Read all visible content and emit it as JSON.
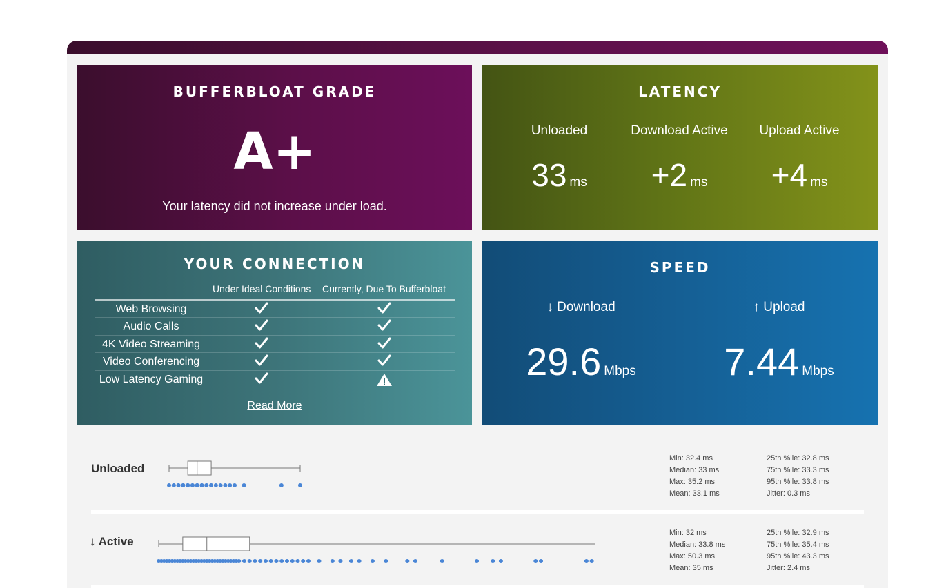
{
  "grade": {
    "title": "BUFFERBLOAT GRADE",
    "value": "A+",
    "description": "Your latency did not increase under load."
  },
  "latency": {
    "title": "LATENCY",
    "columns": [
      {
        "label": "Unloaded",
        "value": "33",
        "unit": "ms"
      },
      {
        "label": "Download Active",
        "value": "+2",
        "unit": "ms"
      },
      {
        "label": "Upload Active",
        "value": "+4",
        "unit": "ms"
      }
    ]
  },
  "connection": {
    "title": "YOUR CONNECTION",
    "col_ideal": "Under Ideal Conditions",
    "col_current": "Currently, Due To Bufferbloat",
    "rows": [
      {
        "name": "Web Browsing",
        "ideal": "check-icon",
        "current": "check-icon"
      },
      {
        "name": "Audio Calls",
        "ideal": "check-icon",
        "current": "check-icon"
      },
      {
        "name": "4K Video Streaming",
        "ideal": "check-icon",
        "current": "check-icon"
      },
      {
        "name": "Video Conferencing",
        "ideal": "check-icon",
        "current": "check-icon"
      },
      {
        "name": "Low Latency Gaming",
        "ideal": "check-icon",
        "current": "warning-icon"
      }
    ],
    "read_more": "Read More"
  },
  "speed": {
    "title": "SPEED",
    "download": {
      "label": "↓ Download",
      "value": "29.6",
      "unit": "Mbps"
    },
    "upload": {
      "label": "↑ Upload",
      "value": "7.44",
      "unit": "Mbps"
    }
  },
  "unloaded": {
    "label": "Unloaded",
    "stats_left": [
      "Min: 32.4 ms",
      "Median: 33 ms",
      "Max: 35.2 ms",
      "Mean: 33.1 ms"
    ],
    "stats_right": [
      "25th %ile: 32.8 ms",
      "75th %ile: 33.3 ms",
      "95th %ile: 33.8 ms",
      "Jitter: 0.3 ms"
    ],
    "box": {
      "min": 32.4,
      "q1": 32.8,
      "median": 33,
      "q3": 33.3,
      "max": 35.2
    },
    "samples": [
      32.4,
      32.5,
      32.5,
      32.6,
      32.6,
      32.7,
      32.7,
      32.8,
      32.8,
      32.8,
      32.9,
      32.9,
      33.0,
      33.0,
      33.0,
      33.1,
      33.1,
      33.2,
      33.2,
      33.3,
      33.3,
      33.4,
      33.5,
      33.6,
      33.7,
      33.8,
      34.0,
      34.8,
      35.2
    ]
  },
  "download_active": {
    "label": "↓ Active",
    "stats_left": [
      "Min: 32 ms",
      "Median: 33.8 ms",
      "Max: 50.3 ms",
      "Mean: 35 ms"
    ],
    "stats_right": [
      "25th %ile: 32.9 ms",
      "75th %ile: 35.4 ms",
      "95th %ile: 43.3 ms",
      "Jitter: 2.4 ms"
    ],
    "box": {
      "min": 32,
      "q1": 32.9,
      "median": 33.8,
      "q3": 35.4,
      "max": 50.3
    },
    "samples": [
      32.0,
      32.1,
      32.2,
      32.3,
      32.4,
      32.5,
      32.6,
      32.7,
      32.8,
      32.9,
      33.0,
      33.1,
      33.2,
      33.3,
      33.4,
      33.5,
      33.6,
      33.7,
      33.8,
      33.9,
      34.0,
      34.1,
      34.2,
      34.3,
      34.4,
      34.5,
      34.6,
      34.7,
      34.8,
      34.9,
      35.0,
      35.2,
      35.4,
      35.6,
      35.8,
      36.0,
      36.2,
      36.4,
      36.6,
      36.8,
      37.0,
      37.2,
      37.4,
      37.6,
      38.0,
      38.5,
      38.8,
      39.2,
      39.5,
      40.0,
      40.5,
      41.3,
      41.6,
      42.6,
      43.9,
      44.5,
      44.8,
      46.1,
      46.3,
      48.0,
      48.2,
      49.1,
      50.2,
      50.3
    ]
  }
}
